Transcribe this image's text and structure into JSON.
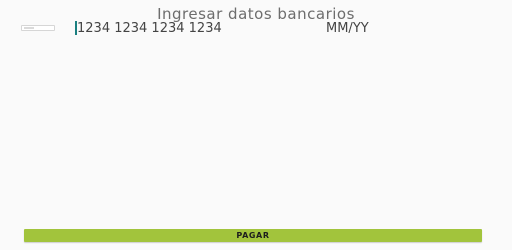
{
  "form": {
    "title": "Ingresar datos bancarios",
    "card_icon": "credit-card-icon",
    "card_number_placeholder": "1234 1234 1234 1234",
    "card_number_value": "",
    "expiry_placeholder": "MM/YY",
    "expiry_value": ""
  },
  "actions": {
    "pay_label": "PAGAR"
  },
  "colors": {
    "button_bg": "#a2c43c",
    "caret": "#1a7f80",
    "background": "#fafafa"
  }
}
